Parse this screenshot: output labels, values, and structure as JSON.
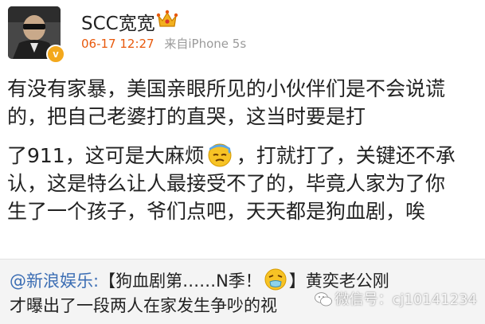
{
  "post": {
    "username": "SCC宽宽",
    "timestamp": "06-17 12:27",
    "source": "来自iPhone 5s",
    "verify_badge": "v",
    "text_lines": [
      "有没有家暴，美国亲眼所见的小伙伴们是不会说谎",
      "的，把自己老婆打的直哭，这当时要是打",
      "了911，这可是大麻烦",
      "，打就打了，关键还不承",
      "认，这是特么让人最接受不了的，毕竟人家为了你",
      "生了一个孩子，爷们点吧，天天都是狗血剧，唉"
    ]
  },
  "repost": {
    "mention": "@新浪娱乐:",
    "line1_a": "【狗血剧第……N季！",
    "line1_b": "】黄奕老公刚",
    "line2": "才曝出了一段两人在家发生争吵的视"
  },
  "watermark": {
    "text": "微信号：cj10141234"
  },
  "colors": {
    "timestamp": "#e8590c",
    "source": "#9a9a9a",
    "mention": "#3c6eb4",
    "repost_bg": "#f4f4f4",
    "badge": "#f3a81c"
  },
  "icons": [
    "crown-icon",
    "verified-v-icon",
    "sweat-emoji-icon",
    "sick-emoji-icon",
    "wechat-icon"
  ]
}
